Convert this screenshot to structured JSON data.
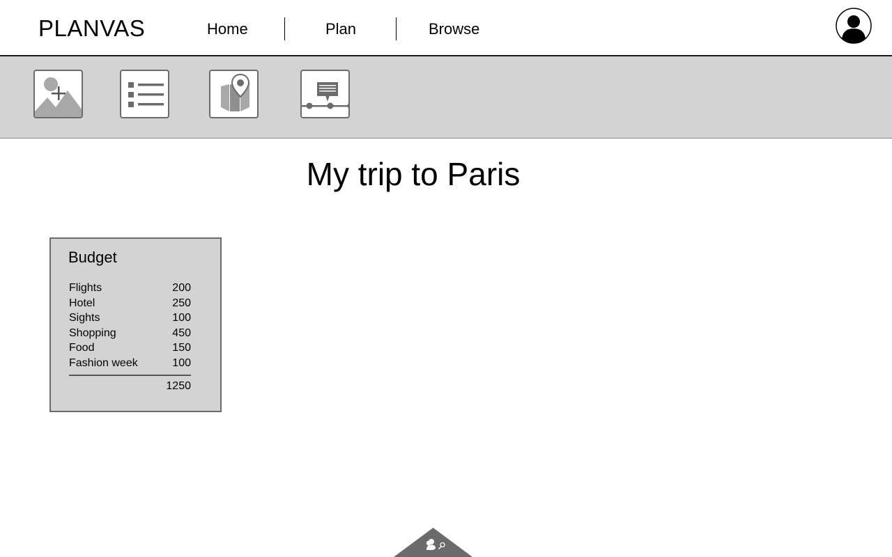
{
  "header": {
    "logo": "PLANVAS",
    "nav": [
      "Home",
      "Plan",
      "Browse"
    ]
  },
  "toolbar": {
    "tools": [
      "add-image-icon",
      "list-icon",
      "map-pin-icon",
      "timeline-comment-icon"
    ]
  },
  "trip": {
    "title": "My trip to Paris"
  },
  "budget": {
    "title": "Budget",
    "items": [
      {
        "label": "Flights",
        "value": "200"
      },
      {
        "label": "Hotel",
        "value": "250"
      },
      {
        "label": "Sights",
        "value": "100"
      },
      {
        "label": "Shopping",
        "value": "450"
      },
      {
        "label": "Food",
        "value": "150"
      },
      {
        "label": "Fashion week",
        "value": "100"
      }
    ],
    "total": "1250"
  },
  "colors": {
    "toolbar_bg": "#d3d3d3",
    "icon_gray": "#6b6b6b",
    "border_dark": "#1a1a1a"
  }
}
